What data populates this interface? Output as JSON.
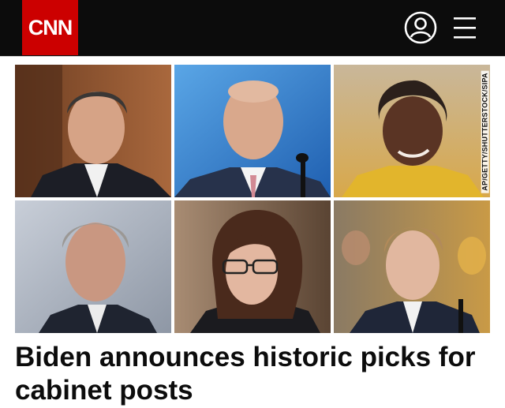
{
  "header": {
    "logo_text": "CNN",
    "brand_color": "#cc0000",
    "background": "#0c0c0c",
    "account_icon": "user-circle-icon",
    "menu_icon": "hamburger-menu-icon"
  },
  "photo_credit": "AP/GETTY/SHUTTERSTOCK/SIPA",
  "headline": "Biden announces historic picks for cabinet posts"
}
